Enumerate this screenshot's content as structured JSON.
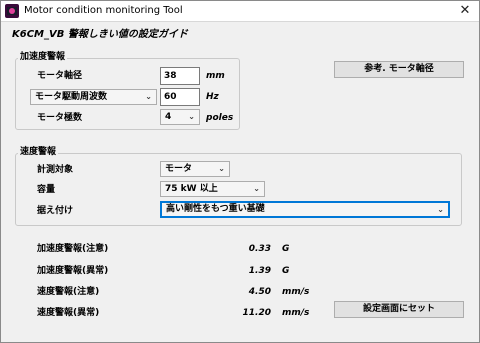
{
  "window": {
    "title": "Motor condition monitoring Tool",
    "close_glyph": "✕",
    "icon": "app-icon"
  },
  "heading": "K6CM_VB 警報しきい値の設定ガイド",
  "accel_group": {
    "label": "加速度警報",
    "motor_shaft_label": "モータ軸径",
    "motor_shaft_value": "38",
    "motor_shaft_unit": "mm",
    "freq_select": "モータ駆動周波数",
    "freq_value": "60",
    "freq_unit": "Hz",
    "poles_label": "モータ極数",
    "poles_value": "4",
    "poles_unit": "poles"
  },
  "reference_button": "参考. モータ軸径",
  "velocity_group": {
    "label": "速度警報",
    "target_label": "計測対象",
    "target_value": "モータ",
    "capacity_label": "容量",
    "capacity_value": "75 kW 以上",
    "mount_label": "据え付け",
    "mount_value": "高い剛性をもつ重い基礎"
  },
  "results": [
    {
      "label": "加速度警報(注意)",
      "value": "0.33",
      "unit": "G"
    },
    {
      "label": "加速度警報(異常)",
      "value": "1.39",
      "unit": "G"
    },
    {
      "label": "速度警報(注意)",
      "value": "4.50",
      "unit": "mm/s"
    },
    {
      "label": "速度警報(異常)",
      "value": "11.20",
      "unit": "mm/s"
    }
  ],
  "set_button": "設定画面にセット",
  "chevron": "⌄",
  "colors": {
    "window_bg": "#f0f0f0",
    "icon_dark": "#3a0a3a",
    "icon_accent": "#e0409a",
    "combo_focus": "#0078d7"
  }
}
